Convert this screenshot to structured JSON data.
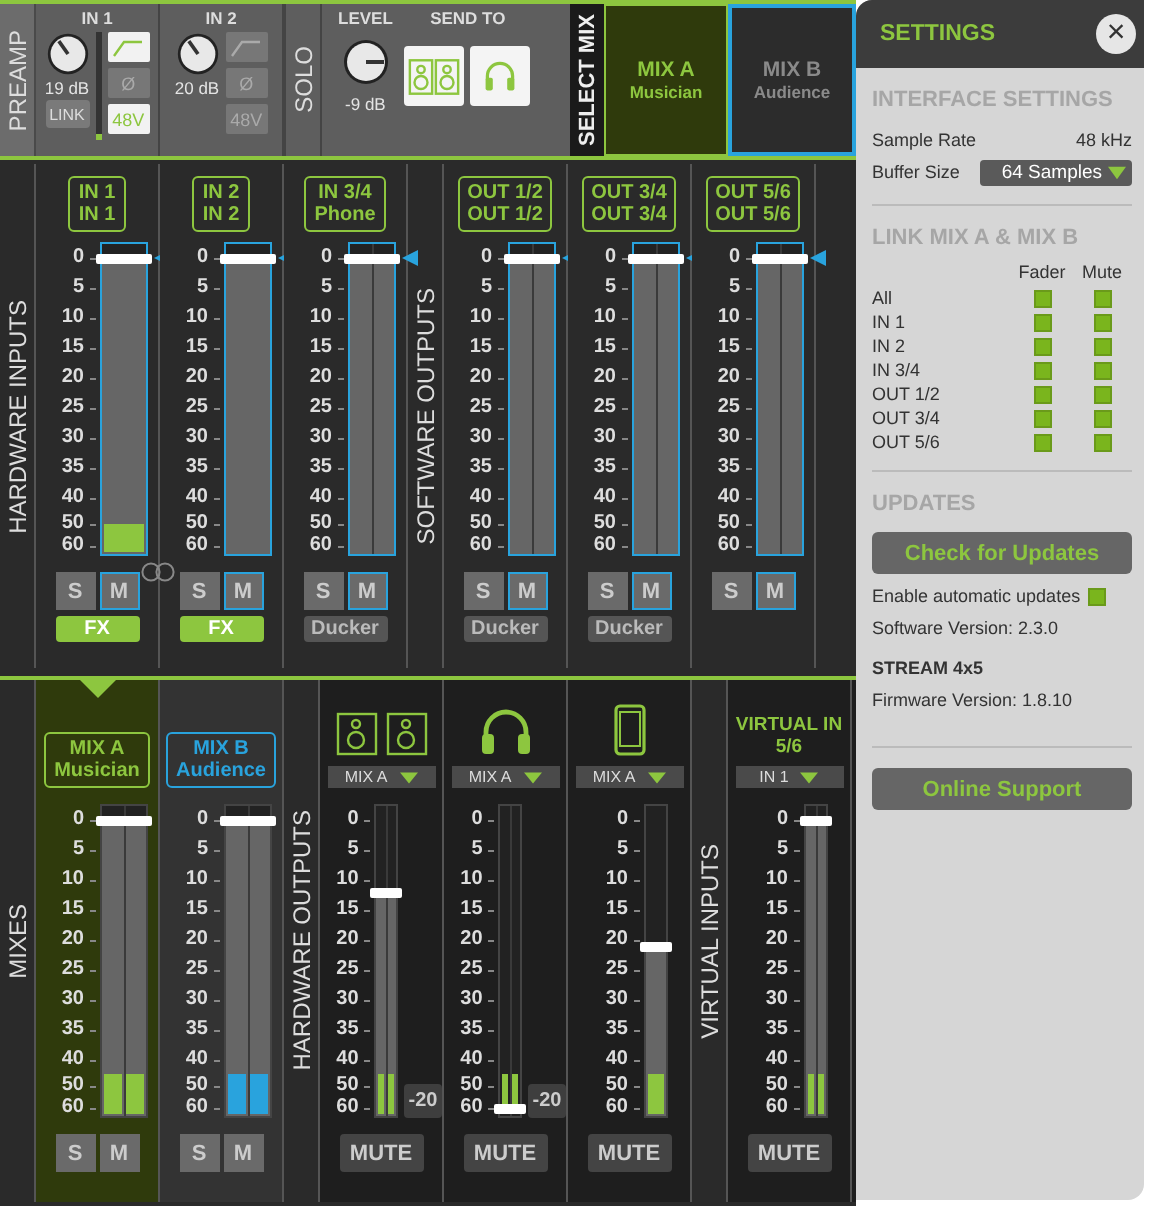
{
  "preamp": {
    "label": "PREAMP",
    "channels": [
      {
        "title": "IN 1",
        "gain": "19 dB",
        "link": "LINK",
        "meter": {
          "level": 0.06
        },
        "hp_filter": {
          "on": true
        },
        "phase": {
          "label": "Ø",
          "on": false
        },
        "phantom": {
          "label": "48V",
          "on": true
        }
      },
      {
        "title": "IN 2",
        "gain": "20 dB",
        "hp_filter": {
          "on": false
        },
        "phase": {
          "label": "Ø",
          "on": false
        },
        "phantom": {
          "label": "48V",
          "on": false
        }
      }
    ]
  },
  "solo": {
    "label": "SOLO",
    "level_title": "LEVEL",
    "reading": "-9 dB",
    "send_to_title": "SEND TO",
    "send_to": [
      {
        "kind": "speakers",
        "on": true
      },
      {
        "kind": "headphones",
        "on": true
      }
    ]
  },
  "select_mix": {
    "label": "SELECT MIX",
    "mixes": [
      {
        "name": "MIX A",
        "sub": "Musician",
        "selected": true,
        "color": "#8dc63f"
      },
      {
        "name": "MIX B",
        "sub": "Audience",
        "selected": false,
        "color": "#29a3dd"
      }
    ]
  },
  "hardware_inputs": {
    "label": "HARDWARE INPUTS",
    "strips": [
      {
        "line1": "IN 1",
        "line2": "IN 1",
        "stereo": false,
        "linked": true,
        "fader": {
          "level": 1
        },
        "meter": {
          "level": 0.09
        },
        "scale": [
          "0",
          "5",
          "10",
          "15",
          "20",
          "25",
          "30",
          "35",
          "40",
          "50",
          "60"
        ],
        "solo": "S",
        "mute": "M",
        "extra": {
          "label": "FX",
          "on": true
        }
      },
      {
        "line1": "IN 2",
        "line2": "IN 2",
        "stereo": false,
        "linked": false,
        "fader": {
          "level": 1
        },
        "scale": [
          "0",
          "5",
          "10",
          "15",
          "20",
          "25",
          "30",
          "35",
          "40",
          "50",
          "60"
        ],
        "solo": "S",
        "mute": "M",
        "extra": {
          "label": "FX",
          "on": true
        }
      },
      {
        "line1": "IN 3/4",
        "line2": "Phone",
        "stereo": true,
        "linked": false,
        "fader": {
          "level": 1
        },
        "scale": [
          "0",
          "5",
          "10",
          "15",
          "20",
          "25",
          "30",
          "35",
          "40",
          "50",
          "60"
        ],
        "solo": "S",
        "mute": "M",
        "extra": {
          "label": "Ducker",
          "on": false
        }
      }
    ]
  },
  "software_outputs": {
    "label": "SOFTWARE OUTPUTS",
    "strips": [
      {
        "line1": "OUT 1/2",
        "line2": "OUT 1/2",
        "stereo": true,
        "linked": false,
        "fader": {
          "level": 1
        },
        "scale": [
          "0",
          "5",
          "10",
          "15",
          "20",
          "25",
          "30",
          "35",
          "40",
          "50",
          "60"
        ],
        "solo": "S",
        "mute": "M",
        "extra": {
          "label": "Ducker",
          "on": false
        }
      },
      {
        "line1": "OUT 3/4",
        "line2": "OUT 3/4",
        "stereo": true,
        "linked": false,
        "fader": {
          "level": 1
        },
        "scale": [
          "0",
          "5",
          "10",
          "15",
          "20",
          "25",
          "30",
          "35",
          "40",
          "50",
          "60"
        ],
        "solo": "S",
        "mute": "M",
        "extra": {
          "label": "Ducker",
          "on": false
        }
      },
      {
        "line1": "OUT 5/6",
        "line2": "OUT 5/6",
        "stereo": true,
        "linked": false,
        "fader": {
          "level": 1
        },
        "scale": [
          "0",
          "5",
          "10",
          "15",
          "20",
          "25",
          "30",
          "35",
          "40",
          "50",
          "60"
        ],
        "solo": "S",
        "mute": "M"
      }
    ]
  },
  "mixes": {
    "label": "MIXES",
    "strips": [
      {
        "line1": "MIX A",
        "line2": "Musician",
        "selected": true,
        "color": "#8dc63f",
        "stereo": true,
        "fader": {
          "level": 1
        },
        "meter": {
          "level": 0.13
        },
        "scale": [
          "0",
          "5",
          "10",
          "15",
          "20",
          "25",
          "30",
          "35",
          "40",
          "50",
          "60"
        ],
        "solo": "S",
        "mute": "M"
      },
      {
        "line1": "MIX B",
        "line2": "Audience",
        "selected": false,
        "color": "#29a3dd",
        "stereo": true,
        "fader": {
          "level": 1
        },
        "meter": {
          "level": 0.13
        },
        "scale": [
          "0",
          "5",
          "10",
          "15",
          "20",
          "25",
          "30",
          "35",
          "40",
          "50",
          "60"
        ],
        "solo": "S",
        "mute": "M"
      }
    ]
  },
  "hardware_outputs": {
    "label": "HARDWARE OUTPUTS",
    "strips": [
      {
        "kind": "speakers",
        "source": "MIX A",
        "stereo": true,
        "fader": {
          "level": 0.75
        },
        "meter": {
          "level": 0.13
        },
        "scale": [
          "0",
          "5",
          "10",
          "15",
          "20",
          "25",
          "30",
          "35",
          "40",
          "50",
          "60"
        ],
        "trim": "-20",
        "mute": "MUTE"
      },
      {
        "kind": "headphones",
        "source": "MIX A",
        "stereo": true,
        "fader": {
          "level": 0
        },
        "meter": {
          "level": 0.13
        },
        "scale": [
          "0",
          "5",
          "10",
          "15",
          "20",
          "25",
          "30",
          "35",
          "40",
          "50",
          "60"
        ],
        "trim": "-20",
        "mute": "MUTE"
      },
      {
        "kind": "phone",
        "source": "MIX A",
        "stereo": false,
        "fader": {
          "level": 0.56
        },
        "meter": {
          "level": 0.13
        },
        "scale": [
          "0",
          "5",
          "10",
          "15",
          "20",
          "25",
          "30",
          "35",
          "40",
          "50",
          "60"
        ],
        "mute": "MUTE"
      }
    ]
  },
  "virtual_inputs": {
    "label": "VIRTUAL INPUTS",
    "strips": [
      {
        "title": "VIRTUAL IN",
        "subtitle": "5/6",
        "source": "IN 1",
        "stereo": true,
        "fader": {
          "level": 1
        },
        "meter": {
          "level": 0.13
        },
        "scale": [
          "0",
          "5",
          "10",
          "15",
          "20",
          "25",
          "30",
          "35",
          "40",
          "50",
          "60"
        ],
        "mute": "MUTE"
      }
    ]
  },
  "settings": {
    "title": "SETTINGS",
    "close": "×",
    "interface": {
      "heading": "INTERFACE SETTINGS",
      "sample_rate_label": "Sample Rate",
      "sample_rate": "48 kHz",
      "buffer_label": "Buffer Size",
      "buffer": "64 Samples"
    },
    "link": {
      "heading": "LINK MIX A & MIX B",
      "columns": [
        "Fader",
        "Mute"
      ],
      "rows": [
        {
          "label": "All",
          "fader": true,
          "mute": true
        },
        {
          "label": "IN 1",
          "fader": true,
          "mute": true
        },
        {
          "label": "IN 2",
          "fader": true,
          "mute": true
        },
        {
          "label": "IN 3/4",
          "fader": true,
          "mute": true
        },
        {
          "label": "OUT 1/2",
          "fader": true,
          "mute": true
        },
        {
          "label": "OUT 3/4",
          "fader": true,
          "mute": true
        },
        {
          "label": "OUT 5/6",
          "fader": true,
          "mute": true
        }
      ]
    },
    "updates": {
      "heading": "UPDATES",
      "check_button": "Check for Updates",
      "auto_label": "Enable automatic updates",
      "auto": true,
      "software_version": "Software Version: 2.3.0"
    },
    "device": {
      "name": "STREAM 4x5",
      "firmware": "Firmware Version: 1.8.10"
    },
    "support_button": "Online Support"
  }
}
